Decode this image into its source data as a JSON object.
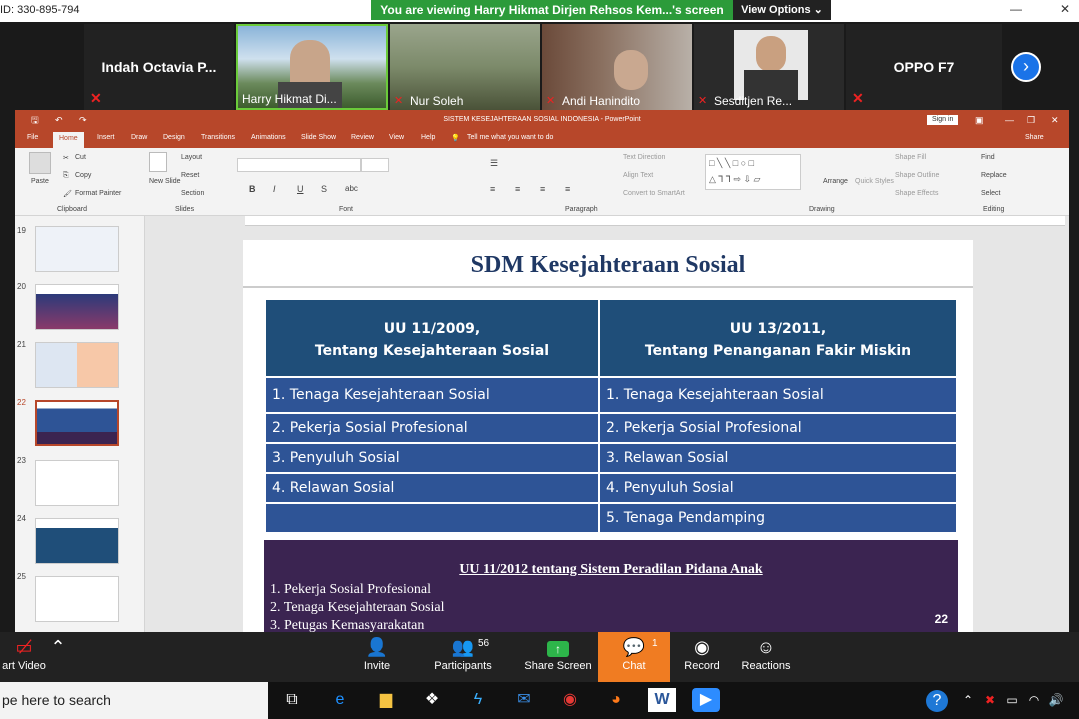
{
  "zoom_top": {
    "meeting_id": "ID: 330-895-794",
    "viewing_banner": "You are viewing Harry Hikmat Dirjen Rehsos Kem...'s screen",
    "view_options": "View Options"
  },
  "gallery": {
    "tiles": [
      {
        "name": "Indah  Octavia  P..."
      },
      {
        "name": "Harry Hikmat Di..."
      },
      {
        "name": "Nur Soleh"
      },
      {
        "name": "Andi Hanindito"
      },
      {
        "name": "Sesditjen Re..."
      },
      {
        "name": "OPPO F7"
      }
    ]
  },
  "ppt": {
    "title": "SISTEM KESEJAHTERAAN SOSIAL INDONESIA  -  PowerPoint",
    "sign_in": "Sign in",
    "share": "Share",
    "tell_me": "Tell me what you want to do",
    "tabs": [
      "File",
      "Home",
      "Insert",
      "Draw",
      "Design",
      "Transitions",
      "Animations",
      "Slide Show",
      "Review",
      "View",
      "Help"
    ],
    "ribbon": {
      "paste": "Paste",
      "cut": "Cut",
      "copy": "Copy",
      "format_painter": "Format Painter",
      "new_slide": "New Slide",
      "layout": "Layout",
      "reset": "Reset",
      "section": "Section",
      "text_direction": "Text Direction",
      "align_text": "Align Text",
      "convert_smartart": "Convert to SmartArt",
      "arrange": "Arrange",
      "quick_styles": "Quick Styles",
      "shape_fill": "Shape Fill",
      "shape_outline": "Shape Outline",
      "shape_effects": "Shape Effects",
      "find": "Find",
      "replace": "Replace",
      "select": "Select",
      "groups": [
        "Clipboard",
        "Slides",
        "Font",
        "Paragraph",
        "Drawing",
        "Editing"
      ]
    },
    "thumbs": [
      "19",
      "20",
      "21",
      "22",
      "23",
      "24",
      "25"
    ]
  },
  "slide": {
    "title": "SDM Kesejahteraan Sosial",
    "col1_h1": "UU 11/2009,",
    "col1_h2": "Tentang Kesejahteraan Sosial",
    "col2_h1": "UU 13/2011,",
    "col2_h2": "Tentang Penanganan Fakir Miskin",
    "rows": [
      [
        "1. Tenaga Kesejahteraan Sosial",
        "1. Tenaga Kesejahteraan Sosial"
      ],
      [
        "2. Pekerja Sosial Profesional",
        "2. Pekerja Sosial Profesional"
      ],
      [
        "3. Penyuluh Sosial",
        "3. Relawan Sosial"
      ],
      [
        "4. Relawan Sosial",
        "4. Penyuluh Sosial"
      ],
      [
        "",
        "5. Tenaga Pendamping"
      ]
    ],
    "uu_title": "UU 11/2012 tentang Sistem Peradilan Pidana Anak",
    "uu_items": [
      "1.   Pekerja Sosial Profesional",
      "2.   Tenaga Kesejahteraan Sosial",
      "3.   Petugas Kemasyarakatan"
    ],
    "page_num": "22"
  },
  "controls": {
    "start_video": "art Video",
    "invite": "Invite",
    "participants": "Participants",
    "participants_count": "56",
    "share_screen": "Share Screen",
    "chat": "Chat",
    "chat_count": "1",
    "record": "Record",
    "reactions": "Reactions"
  },
  "taskbar": {
    "search_placeholder": "pe here to search"
  }
}
